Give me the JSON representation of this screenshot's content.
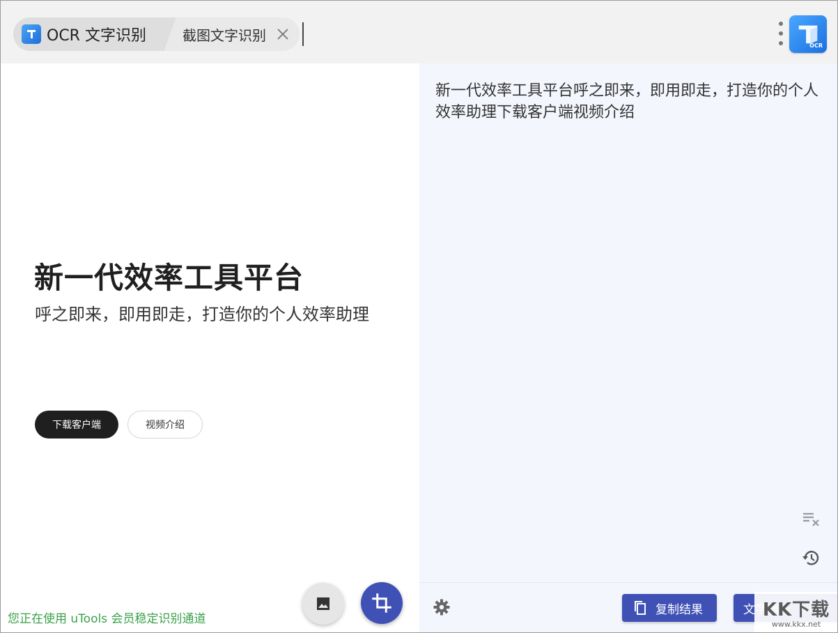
{
  "tabs": {
    "main_label": "OCR 文字识别",
    "sub_label": "截图文字识别"
  },
  "left": {
    "hero_title": "新一代效率工具平台",
    "hero_subtitle": "呼之即来，即用即走，打造你的个人效率助理",
    "download_button": "下载客户端",
    "video_button": "视频介绍",
    "status": "您正在使用 uTools 会员稳定识别通道"
  },
  "right": {
    "result_text": "新一代效率工具平台呼之即来，即用即走，打造你的个人效率助理下载客户端视频介绍",
    "copy_button": "复制结果",
    "translate_button": "文字翻译"
  },
  "app_logo_text": "OCR",
  "watermark": {
    "main": "KK下载",
    "sub": "www.kkx.net"
  },
  "colors": {
    "accent": "#3f51b5",
    "status_green": "#3aa14a",
    "right_panel_bg": "#f4f6fd",
    "topbar_bg": "#f2f2f2"
  },
  "icons": [
    "app-icon",
    "close-icon",
    "more-vert-icon",
    "image-icon",
    "crop-icon",
    "clear-all-icon",
    "history-icon",
    "settings-icon",
    "copy-icon"
  ]
}
